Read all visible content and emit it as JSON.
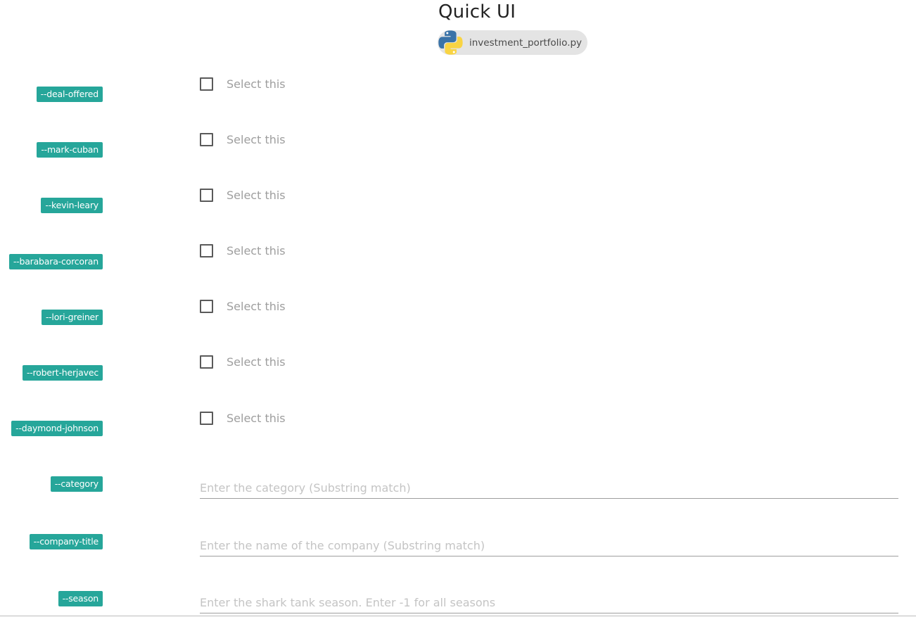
{
  "app": {
    "title": "Quick UI",
    "file_name": "investment_portfolio.py",
    "file_icon": "python-logo-icon"
  },
  "colors": {
    "tag_background": "#26a69a",
    "tag_text": "#ffffff",
    "chip_background": "#e4e4e4"
  },
  "checkbox_options": [
    {
      "flag": "--deal-offered",
      "label": "Select this",
      "checked": false
    },
    {
      "flag": "--mark-cuban",
      "label": "Select this",
      "checked": false
    },
    {
      "flag": "--kevin-leary",
      "label": "Select this",
      "checked": false
    },
    {
      "flag": "--barabara-corcoran",
      "label": "Select this",
      "checked": false
    },
    {
      "flag": "--lori-greiner",
      "label": "Select this",
      "checked": false
    },
    {
      "flag": "--robert-herjavec",
      "label": "Select this",
      "checked": false
    },
    {
      "flag": "--daymond-johnson",
      "label": "Select this",
      "checked": false
    }
  ],
  "text_options": [
    {
      "flag": "--category",
      "value": "",
      "placeholder": "Enter the category (Substring match)"
    },
    {
      "flag": "--company-title",
      "value": "",
      "placeholder": "Enter the name of the company (Substring match)"
    },
    {
      "flag": "--season",
      "value": "",
      "placeholder": "Enter the shark tank season. Enter -1 for all seasons"
    }
  ]
}
